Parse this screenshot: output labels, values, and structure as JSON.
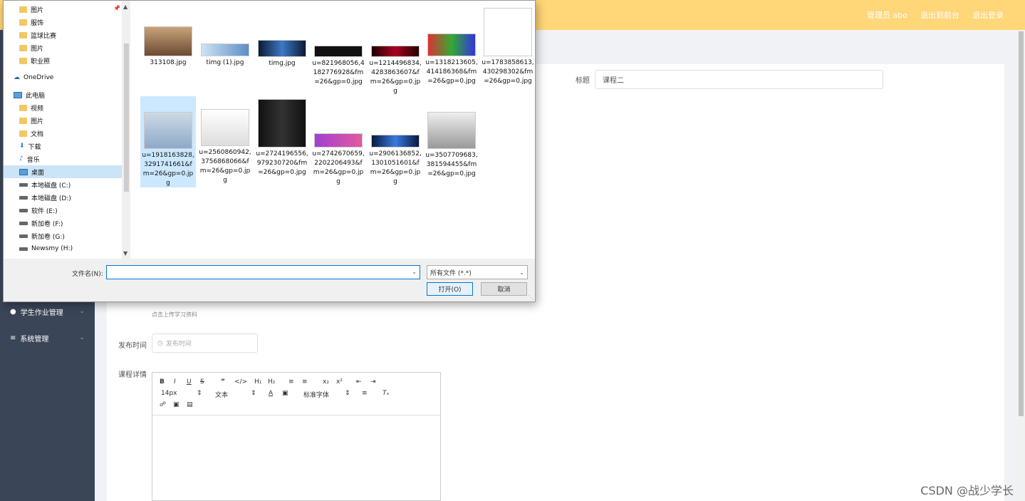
{
  "topbar": {
    "admin": "管理员 abo",
    "goto_front": "退出到前台",
    "logout": "退出登录"
  },
  "sidebar": [
    {
      "label": "学生作业管理"
    },
    {
      "label": "系统管理"
    }
  ],
  "form": {
    "title_label": "标题",
    "title_value": "课程二",
    "upload_hint": "点击上传学习资料",
    "publish_label": "发布时间",
    "publish_placeholder": "发布时间",
    "detail_label": "课程详情"
  },
  "editor": {
    "font_size": "14px",
    "text_type": "文本",
    "font_family": "标准字体"
  },
  "dialog": {
    "nav": [
      {
        "label": "图片",
        "icon": "picture-folder-icon"
      },
      {
        "label": "服饰",
        "icon": "folder-icon"
      },
      {
        "label": "篮球比赛",
        "icon": "folder-icon"
      },
      {
        "label": "图片",
        "icon": "folder-icon"
      },
      {
        "label": "职业照",
        "icon": "folder-icon"
      },
      {
        "label": "OneDrive",
        "icon": "cloud-icon"
      },
      {
        "label": "此电脑",
        "icon": "computer-icon"
      },
      {
        "label": "视频",
        "icon": "video-folder-icon"
      },
      {
        "label": "图片",
        "icon": "picture-folder-icon"
      },
      {
        "label": "文档",
        "icon": "document-folder-icon"
      },
      {
        "label": "下载",
        "icon": "download-icon"
      },
      {
        "label": "音乐",
        "icon": "music-icon"
      },
      {
        "label": "桌面",
        "icon": "desktop-icon"
      },
      {
        "label": "本地磁盘 (C:)",
        "icon": "drive-icon"
      },
      {
        "label": "本地磁盘 (D:)",
        "icon": "drive-icon"
      },
      {
        "label": "软件 (E:)",
        "icon": "drive-icon"
      },
      {
        "label": "新加卷 (F:)",
        "icon": "drive-icon"
      },
      {
        "label": "新加卷 (G:)",
        "icon": "drive-icon"
      },
      {
        "label": "Newsmy (H:)",
        "icon": "drive-icon"
      }
    ],
    "files": [
      {
        "name": "313108.jpg"
      },
      {
        "name": "timg (1).jpg"
      },
      {
        "name": "timg.jpg"
      },
      {
        "name": "u=821968056,4182776928&fm=26&gp=0.jpg"
      },
      {
        "name": "u=1214496834,4283863607&fm=26&gp=0.jpg"
      },
      {
        "name": "u=1318213605,414186368&fm=26&gp=0.jpg"
      },
      {
        "name": "u=1783858613,430298302&fm=26&gp=0.jpg"
      },
      {
        "name": "u=1918163828,3291741661&fm=26&gp=0.jpg"
      },
      {
        "name": "u=2560860942,3756868066&fm=26&gp=0.jpg"
      },
      {
        "name": "u=2724196556,979230720&fm=26&gp=0.jpg"
      },
      {
        "name": "u=2742670659,2202206493&fm=26&gp=0.jpg"
      },
      {
        "name": "u=2906136852,1301051601&fm=26&gp=0.jpg"
      },
      {
        "name": "u=3507709683,381594455&fm=26&gp=0.jpg"
      }
    ],
    "filename_label": "文件名(N):",
    "filename_value": "",
    "filetype": "所有文件 (*.*)",
    "open_button": "打开(O)",
    "cancel_button": "取消"
  },
  "watermark": "CSDN @战少学长"
}
